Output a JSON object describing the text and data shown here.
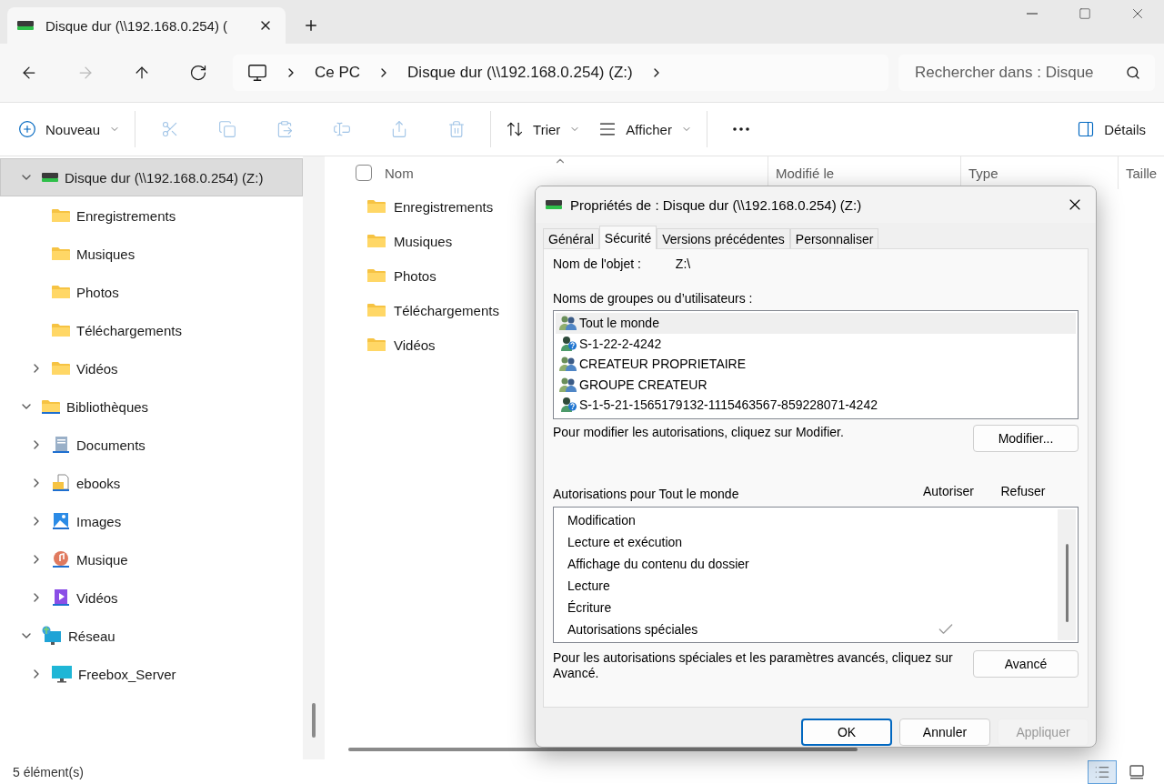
{
  "window": {
    "tab_title": "Disque dur (\\\\192.168.0.254) ("
  },
  "nav": [
    {
      "disabled": false
    },
    {
      "disabled": true
    },
    {
      "disabled": false
    },
    {
      "disabled": false
    }
  ],
  "breadcrumb": [
    "Ce PC",
    "Disque dur (\\\\192.168.0.254) (Z:)"
  ],
  "search": {
    "placeholder": "Rechercher dans : Disque"
  },
  "toolbar": [
    {
      "kind": "new",
      "label": "Nouveau",
      "disabled": false
    },
    {
      "kind": "cut",
      "disabled": true
    },
    {
      "kind": "copy",
      "disabled": true
    },
    {
      "kind": "paste",
      "disabled": true
    },
    {
      "kind": "rename",
      "disabled": true
    },
    {
      "kind": "share",
      "disabled": true
    },
    {
      "kind": "delete",
      "disabled": true
    },
    {
      "kind": "sort",
      "label": "Trier",
      "disabled": false
    },
    {
      "kind": "view",
      "label": "Afficher",
      "disabled": false
    },
    {
      "kind": "more",
      "disabled": false
    }
  ],
  "details_button": {
    "label": "Détails"
  },
  "sidebar": {
    "tree": [
      {
        "label": "Disque dur (\\\\192.168.0.254) (Z:)",
        "kind": "drive",
        "selected": true,
        "expanded": true,
        "children": [
          {
            "label": "Enregistrements",
            "kind": "folder",
            "selected": false
          },
          {
            "label": "Musiques",
            "kind": "folder",
            "selected": false
          },
          {
            "label": "Photos",
            "kind": "folder",
            "selected": false
          },
          {
            "label": "Téléchargements",
            "kind": "folder",
            "selected": false
          },
          {
            "label": "Vidéos",
            "kind": "folder",
            "selected": false,
            "expanded": false
          }
        ]
      },
      {
        "label": "Bibliothèques",
        "kind": "library",
        "selected": false,
        "expanded": true,
        "children": [
          {
            "label": "Documents",
            "kind": "documents",
            "selected": false,
            "expanded": false
          },
          {
            "label": "ebooks",
            "kind": "ebooks",
            "selected": false,
            "expanded": false
          },
          {
            "label": "Images",
            "kind": "images",
            "selected": false,
            "expanded": false
          },
          {
            "label": "Musique",
            "kind": "music",
            "selected": false,
            "expanded": false
          },
          {
            "label": "Vidéos",
            "kind": "videos",
            "selected": false,
            "expanded": false
          }
        ]
      },
      {
        "label": "Réseau",
        "kind": "network",
        "selected": false,
        "expanded": true,
        "children": [
          {
            "label": "Freebox_Server",
            "kind": "computer",
            "selected": false,
            "expanded": false
          }
        ]
      }
    ]
  },
  "table": {
    "select_all": {
      "checked": false
    },
    "columns": [
      "Nom",
      "Modifié le",
      "Type",
      "Taille"
    ],
    "rows": [
      {
        "name": "Enregistrements"
      },
      {
        "name": "Musiques"
      },
      {
        "name": "Photos"
      },
      {
        "name": "Téléchargements"
      },
      {
        "name": "Vidéos"
      }
    ]
  },
  "status_bar": {
    "count": "5 élément(s)",
    "views": [
      {
        "kind": "details",
        "selected": true
      },
      {
        "kind": "large",
        "selected": false
      }
    ]
  },
  "dialog": {
    "title": "Propriétés de : Disque dur (\\\\192.168.0.254) (Z:)",
    "tabs": [
      {
        "label": "Général",
        "selected": false
      },
      {
        "label": "Sécurité",
        "selected": true
      },
      {
        "label": "Versions précédentes",
        "selected": false
      },
      {
        "label": "Personnaliser",
        "selected": false
      }
    ],
    "object_label": "Nom de l'objet :",
    "object_value": "Z:\\",
    "groups_label": "Noms de groupes ou d’utilisateurs :",
    "groups": [
      {
        "name": "Tout le monde",
        "kind": "group",
        "selected": true
      },
      {
        "name": "S-1-22-2-4242",
        "kind": "unknown",
        "selected": false
      },
      {
        "name": "CREATEUR PROPRIETAIRE",
        "kind": "group",
        "selected": false
      },
      {
        "name": "GROUPE CREATEUR",
        "kind": "group",
        "selected": false
      },
      {
        "name": "S-1-5-21-1565179132-1115463567-859228071-4242",
        "kind": "unknown",
        "selected": false
      }
    ],
    "modify_hint": "Pour modifier les autorisations, cliquez sur Modifier.",
    "modify_button": "Modifier...",
    "permissions_label": "Autorisations pour Tout le monde",
    "permission_columns": [
      "Autoriser",
      "Refuser"
    ],
    "permissions": [
      {
        "name": "Modification",
        "allow": false,
        "deny": false
      },
      {
        "name": "Lecture et exécution",
        "allow": false,
        "deny": false
      },
      {
        "name": "Affichage du contenu du dossier",
        "allow": false,
        "deny": false
      },
      {
        "name": "Lecture",
        "allow": false,
        "deny": false
      },
      {
        "name": "Écriture",
        "allow": false,
        "deny": false
      },
      {
        "name": "Autorisations spéciales",
        "allow": true,
        "deny": false
      }
    ],
    "advanced_hint": "Pour les autorisations spéciales et les paramètres avancés, cliquez sur Avancé.",
    "advanced_button": "Avancé",
    "buttons": [
      {
        "label": "OK",
        "kind": "default",
        "disabled": false
      },
      {
        "label": "Annuler",
        "kind": "normal",
        "disabled": false
      },
      {
        "label": "Appliquer",
        "kind": "normal",
        "disabled": true
      }
    ]
  }
}
